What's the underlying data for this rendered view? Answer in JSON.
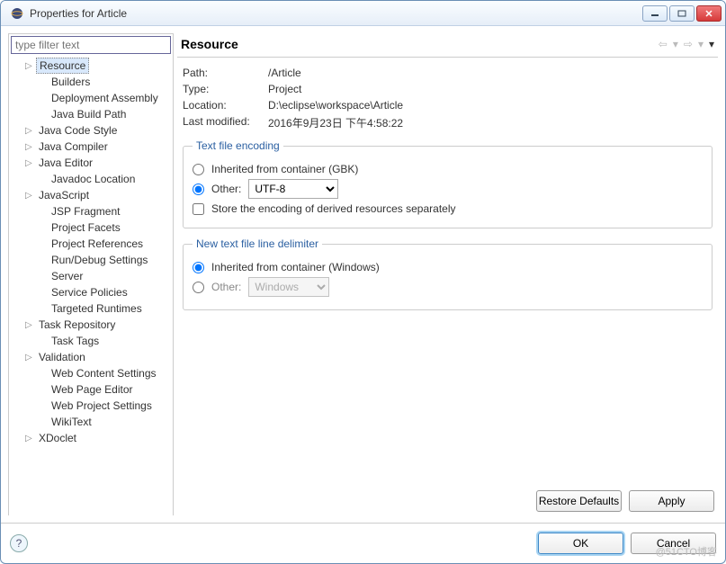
{
  "window": {
    "title": "Properties for Article"
  },
  "sidebar": {
    "filter_placeholder": "type filter text",
    "items": [
      {
        "label": "Resource",
        "expandable": true,
        "selected": true,
        "indent": 1
      },
      {
        "label": "Builders",
        "indent": 2
      },
      {
        "label": "Deployment Assembly",
        "indent": 2
      },
      {
        "label": "Java Build Path",
        "indent": 2
      },
      {
        "label": "Java Code Style",
        "expandable": true,
        "indent": 1
      },
      {
        "label": "Java Compiler",
        "expandable": true,
        "indent": 1
      },
      {
        "label": "Java Editor",
        "expandable": true,
        "indent": 1
      },
      {
        "label": "Javadoc Location",
        "indent": 2
      },
      {
        "label": "JavaScript",
        "expandable": true,
        "indent": 1
      },
      {
        "label": "JSP Fragment",
        "indent": 2
      },
      {
        "label": "Project Facets",
        "indent": 2
      },
      {
        "label": "Project References",
        "indent": 2
      },
      {
        "label": "Run/Debug Settings",
        "indent": 2
      },
      {
        "label": "Server",
        "indent": 2
      },
      {
        "label": "Service Policies",
        "indent": 2
      },
      {
        "label": "Targeted Runtimes",
        "indent": 2
      },
      {
        "label": "Task Repository",
        "expandable": true,
        "indent": 1
      },
      {
        "label": "Task Tags",
        "indent": 2
      },
      {
        "label": "Validation",
        "expandable": true,
        "indent": 1
      },
      {
        "label": "Web Content Settings",
        "indent": 2
      },
      {
        "label": "Web Page Editor",
        "indent": 2
      },
      {
        "label": "Web Project Settings",
        "indent": 2
      },
      {
        "label": "WikiText",
        "indent": 2
      },
      {
        "label": "XDoclet",
        "expandable": true,
        "indent": 1
      }
    ]
  },
  "page": {
    "title": "Resource",
    "path_label": "Path:",
    "path_value": "/Article",
    "type_label": "Type:",
    "type_value": "Project",
    "location_label": "Location:",
    "location_value": "D:\\eclipse\\workspace\\Article",
    "modified_label": "Last modified:",
    "modified_value": "2016年9月23日 下午4:58:22"
  },
  "encoding": {
    "legend": "Text file encoding",
    "inherited_label": "Inherited from container (GBK)",
    "other_label": "Other:",
    "other_value": "UTF-8",
    "store_label": "Store the encoding of derived resources separately"
  },
  "delimiter": {
    "legend": "New text file line delimiter",
    "inherited_label": "Inherited from container (Windows)",
    "other_label": "Other:",
    "other_value": "Windows"
  },
  "buttons": {
    "restore": "Restore Defaults",
    "apply": "Apply",
    "ok": "OK",
    "cancel": "Cancel"
  },
  "watermark": "@51CTO博客"
}
